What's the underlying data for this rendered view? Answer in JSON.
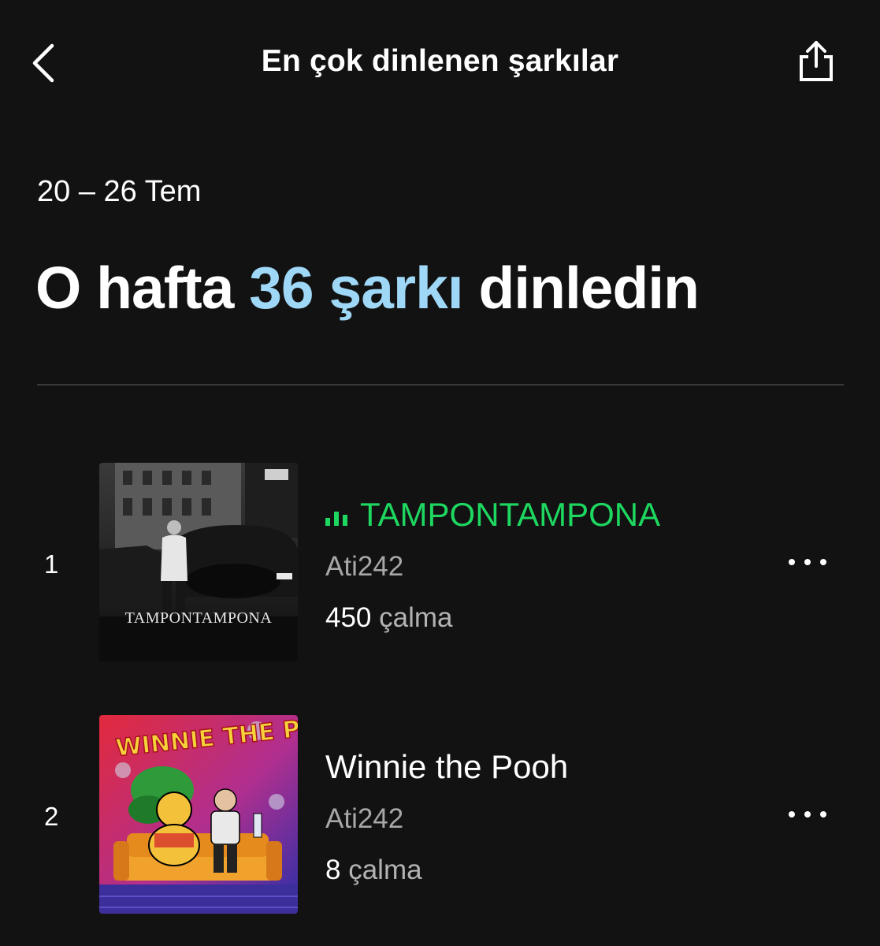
{
  "header": {
    "title": "En çok dinlenen şarkılar",
    "back_icon": "chevron-left-icon",
    "share_icon": "share-icon"
  },
  "summary": {
    "date_range": "20 – 26 Tem",
    "headline_prefix": "O hafta",
    "headline_accent": "36 şarkı",
    "headline_suffix": "dinledin",
    "accent_color": "#9fd8f7"
  },
  "tracks": [
    {
      "rank": "1",
      "title": "TAMPONTAMPONA",
      "artist": "Ati242",
      "plays_count": "450",
      "plays_unit": "çalma",
      "is_playing": true,
      "cover_text": "TAMPONTAMPONA"
    },
    {
      "rank": "2",
      "title": "Winnie the Pooh",
      "artist": "Ati242",
      "plays_count": "8",
      "plays_unit": "çalma",
      "is_playing": false,
      "cover_text": "WINNIE THE POOH"
    }
  ],
  "colors": {
    "background": "#121212",
    "playing_green": "#1ed760",
    "secondary_text": "#a7a7a7",
    "divider": "#3a3a3a"
  }
}
